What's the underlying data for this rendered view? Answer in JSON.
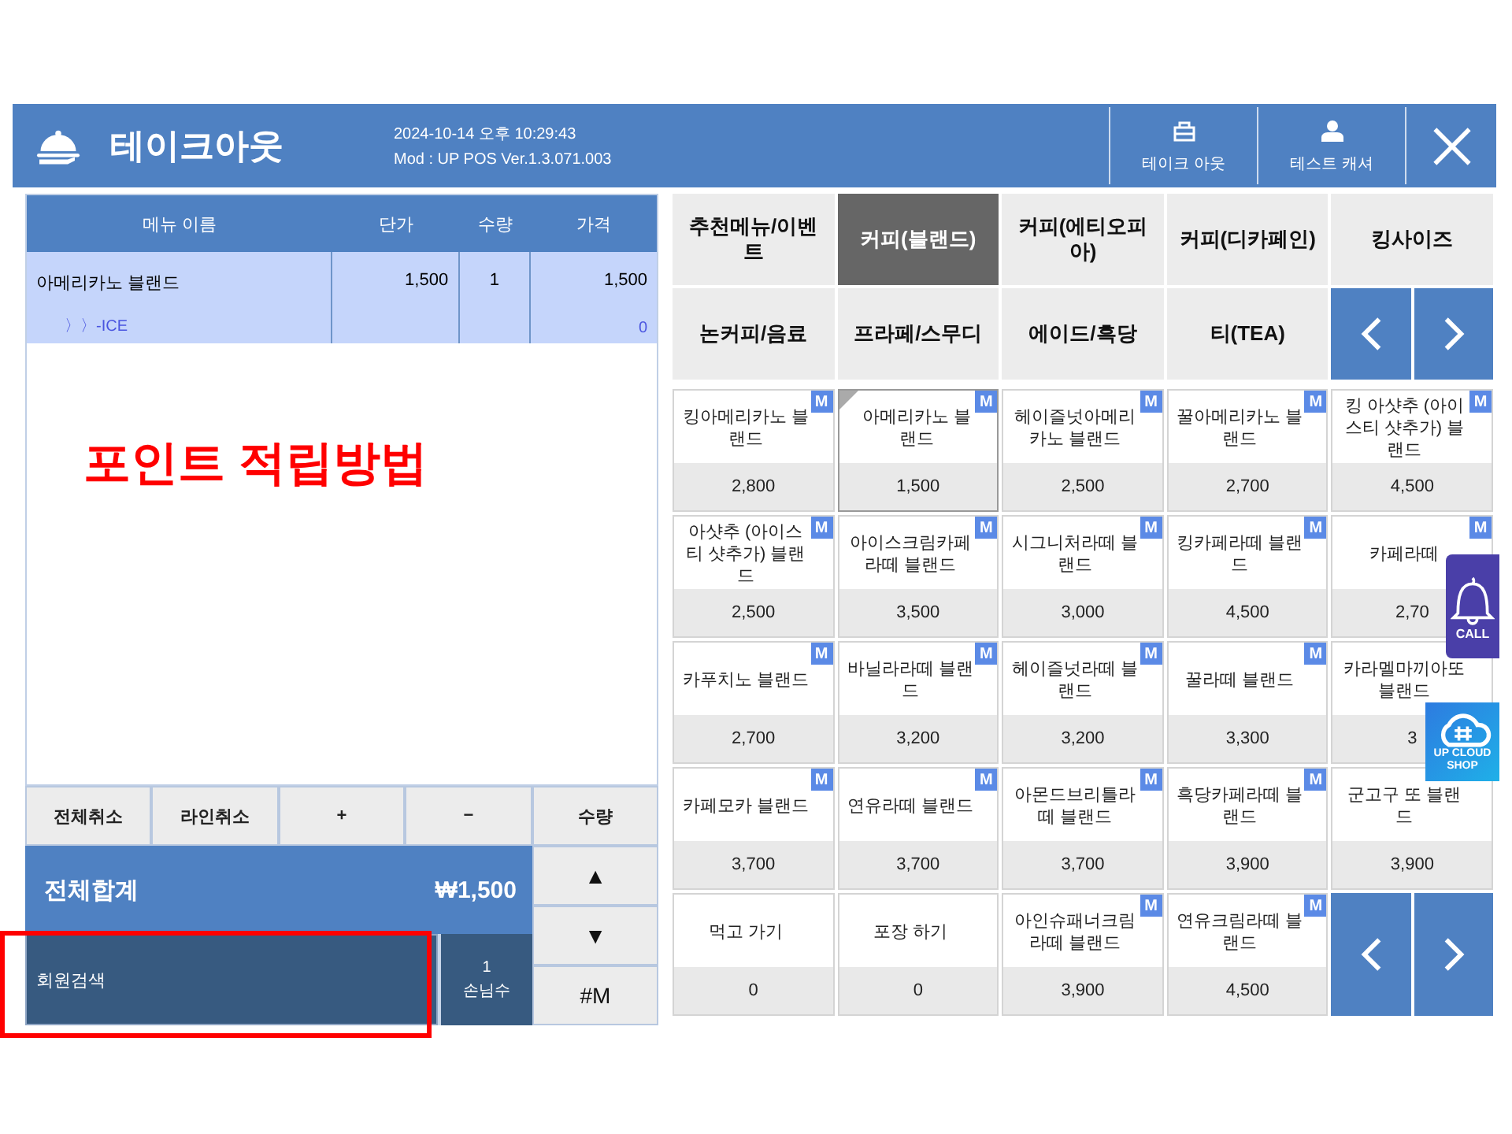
{
  "window": {
    "title": "테이크아웃",
    "datetime": "2024-10-14 오후 10:29:43",
    "version": "Mod : UP POS Ver.1.3.071.003"
  },
  "header_buttons": [
    {
      "kind": "bag",
      "label": "테이크 아웃"
    },
    {
      "kind": "person",
      "label": "테스트 캐셔"
    },
    {
      "kind": "close"
    }
  ],
  "order_table": {
    "columns": [
      "메뉴 이름",
      "단가",
      "수량",
      "가격"
    ],
    "rows": [
      {
        "name": "아메리카노 블랜드",
        "option": "〉〉-ICE",
        "unit_price": "1,500",
        "qty": "1",
        "price": "1,500",
        "option_price": "0"
      }
    ]
  },
  "annotation": {
    "text": "포인트 적립방법"
  },
  "order_buttons": [
    "전체취소",
    "라인취소",
    "+",
    "−",
    "수량"
  ],
  "total": {
    "label": "전체합계",
    "amount": "₩1,500"
  },
  "member_search": {
    "label": "회원검색",
    "highlighted": true
  },
  "guests": {
    "count": "1",
    "label": "손님수"
  },
  "side_buttons": [
    "▲",
    "▼",
    "#M"
  ],
  "categories": [
    {
      "label": "추천메뉴/이벤트",
      "selected": false
    },
    {
      "label": "커피(블랜드)",
      "selected": true
    },
    {
      "label": "커피(에티오피아)",
      "selected": false
    },
    {
      "label": "커피(디카페인)",
      "selected": false
    },
    {
      "label": "킹사이즈",
      "selected": false
    },
    {
      "label": "논커피/음료",
      "selected": false
    },
    {
      "label": "프라페/스무디",
      "selected": false
    },
    {
      "label": "에이드/흑당",
      "selected": false
    },
    {
      "label": "티(TEA)",
      "selected": false
    }
  ],
  "menu_items": [
    {
      "name": "킹아메리카노 블랜드",
      "price": "2,800",
      "badge": "M",
      "selected": false
    },
    {
      "name": "아메리카노 블랜드",
      "price": "1,500",
      "badge": "M",
      "selected": true
    },
    {
      "name": "헤이즐넛아메리카노 블랜드",
      "price": "2,500",
      "badge": "M",
      "selected": false
    },
    {
      "name": "꿀아메리카노 블랜드",
      "price": "2,700",
      "badge": "M",
      "selected": false
    },
    {
      "name": "킹 아샷추 (아이스티 샷추가) 블랜드",
      "price": "4,500",
      "badge": "M",
      "selected": false
    },
    {
      "name": "아샷추 (아이스티 샷추가) 블랜드",
      "price": "2,500",
      "badge": "M",
      "selected": false
    },
    {
      "name": "아이스크림카페라떼 블랜드",
      "price": "3,500",
      "badge": "M",
      "selected": false
    },
    {
      "name": "시그니처라떼 블랜드",
      "price": "3,000",
      "badge": "M",
      "selected": false
    },
    {
      "name": "킹카페라떼 블랜드",
      "price": "4,500",
      "badge": "M",
      "selected": false
    },
    {
      "name": "카페라떼",
      "price": "2,70",
      "badge": "M",
      "selected": false
    },
    {
      "name": "카푸치노 블랜드",
      "price": "2,700",
      "badge": "M",
      "selected": false
    },
    {
      "name": "바닐라라떼 블랜드",
      "price": "3,200",
      "badge": "M",
      "selected": false
    },
    {
      "name": "헤이즐넛라떼 블랜드",
      "price": "3,200",
      "badge": "M",
      "selected": false
    },
    {
      "name": "꿀라떼 블랜드",
      "price": "3,300",
      "badge": "M",
      "selected": false
    },
    {
      "name": "카라멜마끼아또 블랜드",
      "price": "3",
      "selected": false
    },
    {
      "name": "카페모카 블랜드",
      "price": "3,700",
      "badge": "M",
      "selected": false
    },
    {
      "name": "연유라떼 블랜드",
      "price": "3,700",
      "badge": "M",
      "selected": false
    },
    {
      "name": "아몬드브리틀라떼 블랜드",
      "price": "3,700",
      "badge": "M",
      "selected": false
    },
    {
      "name": "흑당카페라떼 블랜드",
      "price": "3,900",
      "badge": "M",
      "selected": false
    },
    {
      "name": "군고구 또 블랜드",
      "price": "3,900",
      "selected": false
    },
    {
      "name": "먹고 가기",
      "price": "0",
      "selected": false
    },
    {
      "name": "포장 하기",
      "price": "0",
      "selected": false
    },
    {
      "name": "아인슈패너크림라떼 블랜드",
      "price": "3,900",
      "badge": "M",
      "selected": false
    },
    {
      "name": "연유크림라떼 블랜드",
      "price": "4,500",
      "badge": "M",
      "selected": false
    }
  ],
  "floating_widgets": [
    {
      "kind": "call",
      "label": "CALL"
    },
    {
      "kind": "cloud",
      "label": "UP CLOUD SHOP"
    }
  ]
}
